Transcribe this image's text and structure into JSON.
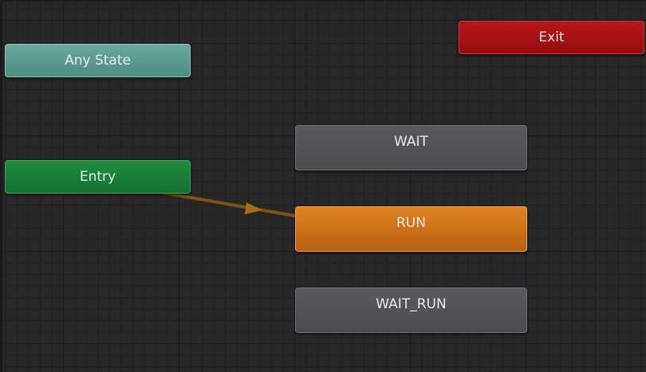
{
  "animator": {
    "nodes": {
      "any_state": "Any State",
      "entry": "Entry",
      "exit": "Exit",
      "wait": "WAIT",
      "run": "RUN",
      "wait_run": "WAIT_RUN"
    },
    "default_transition": {
      "from": "Entry",
      "to": "RUN"
    },
    "colors": {
      "any_state": "#5a9b8f",
      "entry": "#177a36",
      "exit": "#a81114",
      "state": "#525356",
      "default_state": "#cf7218",
      "transition": "#8a5a10",
      "background": "#272727"
    }
  }
}
